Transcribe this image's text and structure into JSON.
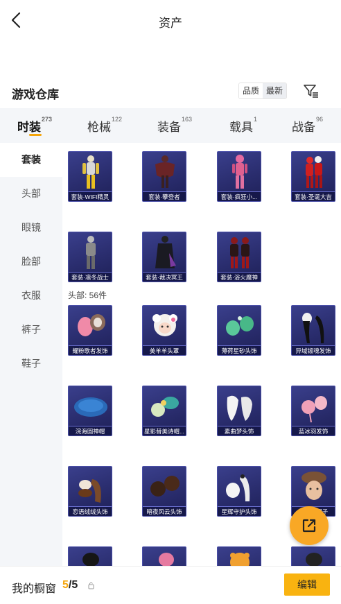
{
  "header": {
    "title": "资产"
  },
  "warehouse": {
    "title": "游戏仓库",
    "sort_options": [
      "品质",
      "最新"
    ],
    "selected_sort": "最新"
  },
  "tabs": [
    {
      "label": "时装",
      "count": "273",
      "active": true
    },
    {
      "label": "枪械",
      "count": "122",
      "active": false
    },
    {
      "label": "装备",
      "count": "163",
      "active": false
    },
    {
      "label": "载具",
      "count": "1",
      "active": false
    },
    {
      "label": "战备",
      "count": "96",
      "active": false
    }
  ],
  "sidebar": {
    "items": [
      {
        "label": "套装",
        "active": true
      },
      {
        "label": "头部"
      },
      {
        "label": "眼镜"
      },
      {
        "label": "脸部"
      },
      {
        "label": "衣服"
      },
      {
        "label": "裤子"
      },
      {
        "label": "鞋子"
      }
    ]
  },
  "sets": {
    "items": [
      {
        "label": "套装·WIFI精灵",
        "icon": "outfit-yellow"
      },
      {
        "label": "套装·攀登者",
        "icon": "outfit-dark-red"
      },
      {
        "label": "套装·疯狂小...",
        "icon": "outfit-pink"
      },
      {
        "label": "套装·圣诞大吉",
        "icon": "outfit-red"
      },
      {
        "label": "套装·凛冬战士",
        "icon": "outfit-grey"
      },
      {
        "label": "套装·裁决冥王",
        "icon": "outfit-black"
      },
      {
        "label": "套装·浴火魔神",
        "icon": "outfit-crimson"
      }
    ]
  },
  "head": {
    "section_label": "头部: 56件",
    "items": [
      {
        "label": "耀粉歌者发饰",
        "icon": "hair-pink"
      },
      {
        "label": "美羊羊头罩",
        "icon": "sheep-mask"
      },
      {
        "label": "薄荷星砂头饰",
        "icon": "hair-mint"
      },
      {
        "label": "异域锻魂发饰",
        "icon": "hair-black-white"
      },
      {
        "label": "浣海固神帽",
        "icon": "hat-blue"
      },
      {
        "label": "星影替美诗帽...",
        "icon": "hair-teal"
      },
      {
        "label": "素曲梦头饰",
        "icon": "hair-white"
      },
      {
        "label": "蓝冰羽发饰",
        "icon": "hair-pink-puff"
      },
      {
        "label": "恋语绒绒头饰",
        "icon": "hair-brown"
      },
      {
        "label": "暗夜风云头饰",
        "icon": "hair-dark-brown"
      },
      {
        "label": "星辉守护头饰",
        "icon": "hair-silver"
      },
      {
        "label": "驯鹿绒帽子",
        "icon": "fur-hat"
      },
      {
        "label": "",
        "icon": "hair-black"
      },
      {
        "label": "",
        "icon": "hair-pink-bun"
      },
      {
        "label": "",
        "icon": "tiger-mask"
      },
      {
        "label": "",
        "icon": "hair-dark"
      }
    ]
  },
  "fab": {
    "icon": "share-icon"
  },
  "bottom": {
    "label": "我的橱窗",
    "current": "5",
    "total": "/5",
    "edit_label": "编辑"
  },
  "colors": {
    "accent": "#f9a825",
    "card_bg": "#2a2d6e",
    "tab_bg": "#f4f6f9"
  }
}
